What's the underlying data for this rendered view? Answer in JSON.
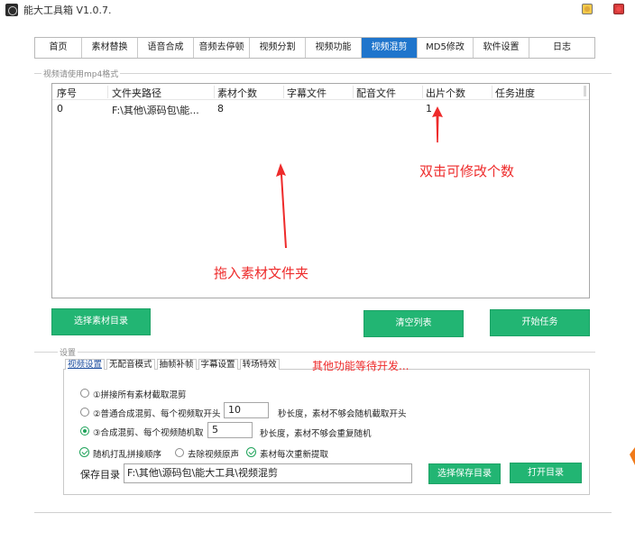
{
  "window": {
    "title": "能大工具箱 V1.0.7.",
    "app_icon": "app-logo-icon",
    "min_color": "#f6c94a",
    "close_color": "#d63a3a"
  },
  "tabs": [
    {
      "label": "首页",
      "active": false
    },
    {
      "label": "素材替换",
      "active": false
    },
    {
      "label": "语音合成",
      "active": false
    },
    {
      "label": "音频去停顿",
      "active": false
    },
    {
      "label": "视频分割",
      "active": false
    },
    {
      "label": "视频功能",
      "active": false
    },
    {
      "label": "视频混剪",
      "active": true
    },
    {
      "label": "MD5修改",
      "active": false
    },
    {
      "label": "软件设置",
      "active": false
    },
    {
      "label": "日志",
      "active": false
    }
  ],
  "list_group": {
    "label": "视频请使用mp4格式",
    "columns": [
      "序号",
      "文件夹路径",
      "素材个数",
      "字幕文件",
      "配音文件",
      "出片个数",
      "任务进度"
    ],
    "rows": [
      {
        "index": "0",
        "path": "F:\\其他\\源码包\\能...",
        "count": "8",
        "subtitle": "",
        "audio": "",
        "output": "1",
        "progress": ""
      }
    ]
  },
  "annotations": {
    "edit_count_hint": "双击可修改个数",
    "drag_hint": "拖入素材文件夹",
    "color": "#ee2b2b"
  },
  "buttons": {
    "select_dir": "选择素材目录",
    "clear_list": "清空列表",
    "start_task": "开始任务",
    "select_save_dir": "选择保存目录",
    "open_dir": "打开目录",
    "accent": "#22b573"
  },
  "settings": {
    "label": "设置",
    "subtabs": [
      {
        "label": "视频设置",
        "active": true
      },
      {
        "label": "无配音模式",
        "active": false
      },
      {
        "label": "抽帧补帧",
        "active": false
      },
      {
        "label": "字幕设置",
        "active": false
      },
      {
        "label": "转场特效",
        "active": false
      }
    ],
    "other_note": "其他功能等待开发...",
    "modes": [
      {
        "label": "①拼接所有素材截取混剪",
        "selected": false
      },
      {
        "label": "②普通合成混剪、每个视频取开头",
        "value": "10",
        "suffix": "秒长度，素材不够会随机截取开头",
        "selected": false
      },
      {
        "label": "③合成混剪、每个视频随机取",
        "value": "5",
        "suffix": "秒长度，素材不够会重复随机",
        "selected": true
      }
    ],
    "checks": [
      {
        "label": "随机打乱拼接顺序",
        "checked": true
      },
      {
        "label": "去除视频原声",
        "checked": false
      },
      {
        "label": "素材每次重新提取",
        "checked": true
      }
    ],
    "save_dir_label": "保存目录",
    "save_dir_value": "F:\\其他\\源码包\\能大工具\\视频混剪"
  }
}
